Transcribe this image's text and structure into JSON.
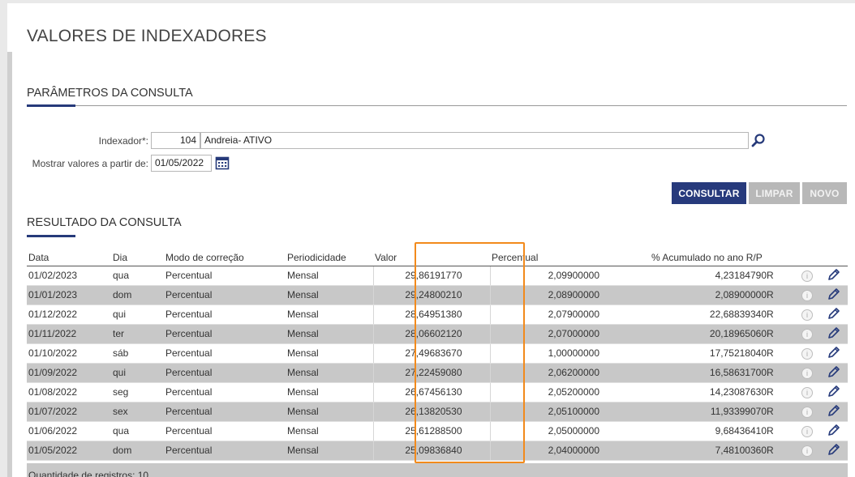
{
  "page": {
    "title": "VALORES DE INDEXADORES"
  },
  "params": {
    "section_title": "PARÂMETROS DA CONSULTA",
    "indexador_label": "Indexador*:",
    "indexador_code": "104",
    "indexador_name": "Andreia- ATIVO",
    "date_label": "Mostrar valores a partir de:",
    "date_value": "01/05/2022"
  },
  "actions": {
    "consultar": "CONSULTAR",
    "limpar": "LIMPAR",
    "novo": "NOVO"
  },
  "results": {
    "section_title": "RESULTADO DA CONSULTA",
    "columns": [
      "Data",
      "Dia",
      "Modo de correção",
      "Periodicidade",
      "Valor",
      "Percentual",
      "% Acumulado no ano R/P"
    ],
    "rows": [
      [
        "01/02/2023",
        "qua",
        "Percentual",
        "Mensal",
        "29,86191770",
        "2,09900000",
        "4,23184790",
        "R"
      ],
      [
        "01/01/2023",
        "dom",
        "Percentual",
        "Mensal",
        "29,24800210",
        "2,08900000",
        "2,08900000",
        "R"
      ],
      [
        "01/12/2022",
        "qui",
        "Percentual",
        "Mensal",
        "28,64951380",
        "2,07900000",
        "22,68839340",
        "R"
      ],
      [
        "01/11/2022",
        "ter",
        "Percentual",
        "Mensal",
        "28,06602120",
        "2,07000000",
        "20,18965060",
        "R"
      ],
      [
        "01/10/2022",
        "sáb",
        "Percentual",
        "Mensal",
        "27,49683670",
        "1,00000000",
        "17,75218040",
        "R"
      ],
      [
        "01/09/2022",
        "qui",
        "Percentual",
        "Mensal",
        "27,22459080",
        "2,06200000",
        "16,58631700",
        "R"
      ],
      [
        "01/08/2022",
        "seg",
        "Percentual",
        "Mensal",
        "26,67456130",
        "2,05200000",
        "14,23087630",
        "R"
      ],
      [
        "01/07/2022",
        "sex",
        "Percentual",
        "Mensal",
        "26,13820530",
        "2,05100000",
        "11,93399070",
        "R"
      ],
      [
        "01/06/2022",
        "qua",
        "Percentual",
        "Mensal",
        "25,61288500",
        "2,05000000",
        "9,68436410",
        "R"
      ],
      [
        "01/05/2022",
        "dom",
        "Percentual",
        "Mensal",
        "25,09836840",
        "2,04000000",
        "7,48100360",
        "R"
      ]
    ],
    "footer": "Quantidade de registros: 10"
  },
  "colors": {
    "primary": "#273a7c",
    "highlight": "#f28a1c",
    "row_alt": "#c8c8c8"
  }
}
